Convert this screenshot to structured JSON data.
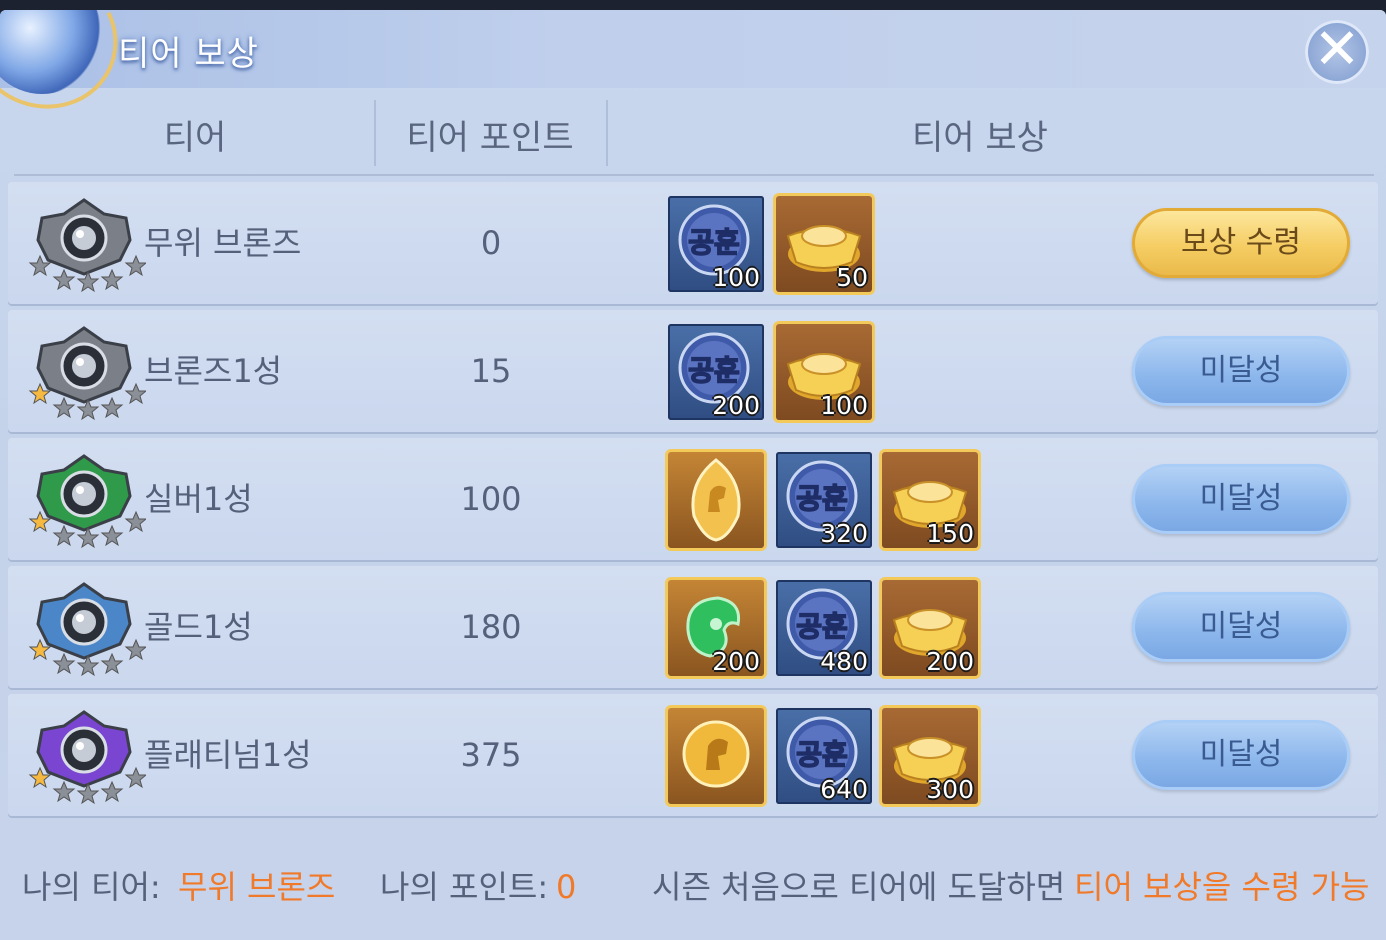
{
  "window": {
    "title": "티어 보상"
  },
  "headers": {
    "tier": "티어",
    "points": "티어 포인트",
    "reward": "티어 보상"
  },
  "rows": [
    {
      "name": "무위 브론즈",
      "points": "0",
      "stars_filled": 0,
      "emblem_color": "#7a7f88",
      "items": [
        {
          "type": "merit",
          "label": "공훈",
          "qty": "100"
        },
        {
          "type": "gold-ingot",
          "qty": "50"
        }
      ],
      "button": "보상 수령",
      "button_state": "claim"
    },
    {
      "name": "브론즈1성",
      "points": "15",
      "stars_filled": 1,
      "emblem_color": "#7a7f88",
      "items": [
        {
          "type": "merit",
          "label": "공훈",
          "qty": "200"
        },
        {
          "type": "gold-ingot",
          "qty": "100"
        }
      ],
      "button": "미달성",
      "button_state": "locked"
    },
    {
      "name": "실버1성",
      "points": "100",
      "stars_filled": 1,
      "emblem_color": "#2f9a4a",
      "items": [
        {
          "type": "horse-token",
          "qty": ""
        },
        {
          "type": "merit",
          "label": "공훈",
          "qty": "320"
        },
        {
          "type": "gold-ingot",
          "qty": "150"
        }
      ],
      "button": "미달성",
      "button_state": "locked"
    },
    {
      "name": "골드1성",
      "points": "180",
      "stars_filled": 1,
      "emblem_color": "#4a86c8",
      "items": [
        {
          "type": "jade",
          "qty": "200"
        },
        {
          "type": "merit",
          "label": "공훈",
          "qty": "480"
        },
        {
          "type": "gold-ingot",
          "qty": "200"
        }
      ],
      "button": "미달성",
      "button_state": "locked"
    },
    {
      "name": "플래티넘1성",
      "points": "375",
      "stars_filled": 1,
      "emblem_color": "#7a45d0",
      "items": [
        {
          "type": "horse-coin",
          "qty": ""
        },
        {
          "type": "merit",
          "label": "공훈",
          "qty": "640"
        },
        {
          "type": "gold-ingot",
          "qty": "300"
        }
      ],
      "button": "미달성",
      "button_state": "locked"
    }
  ],
  "footer": {
    "my_tier_label": "나의 티어:",
    "my_tier_value": "무위 브론즈",
    "my_points_label": "나의 포인트:",
    "my_points_value": "0",
    "notice_prefix": "시즌 처음으로 티어에 도달하면",
    "notice_highlight": "티어 보상을 수령 가능"
  },
  "colors": {
    "highlight": "#f07a2a",
    "text": "#55607a",
    "claim_button": "#f5cd63",
    "locked_button": "#8bb6ec"
  }
}
